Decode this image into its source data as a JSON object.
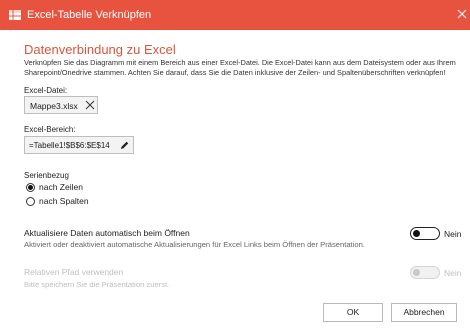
{
  "window": {
    "title": "Excel-Tabelle Verknüpfen",
    "accent_color": "#e8533f"
  },
  "main": {
    "heading": "Datenverbindung zu Excel",
    "description": "Verknüpfen Sie das Diagramm mit einem Bereich aus einer Excel-Datei. Die Excel-Datei kann aus dem Dateisystem oder aus Ihrem Sharepoint/Onedrive stammen. Achten Sie darauf, dass Sie die Daten inklusive der Zeilen- und Spaltenüberschriften verknüpfen!",
    "file_label": "Excel-Datei:",
    "file_value": "Mappe3.xlsx",
    "range_label": "Excel-Bereich:",
    "range_value": "=Tabelle1!$B$6:$E$14",
    "series_label": "Serienbezug",
    "series_options": [
      "nach Zeilen",
      "nach Spalten"
    ],
    "series_selected": "nach Zeilen"
  },
  "options": {
    "auto_update": {
      "title": "Aktualisiere Daten automatisch beim Öffnen",
      "subtitle": "Aktiviert oder deaktiviert automatische Aktualisierungen für Excel Links beim Öffnen der Präsentation.",
      "state_text": "Nein"
    },
    "relative_path": {
      "title": "Relativen Pfad verwenden",
      "subtitle": "Bitte speichern Sie die Präsentation zuerst.",
      "state_text": "Nein"
    }
  },
  "buttons": {
    "ok": "OK",
    "cancel": "Abbrechen"
  }
}
